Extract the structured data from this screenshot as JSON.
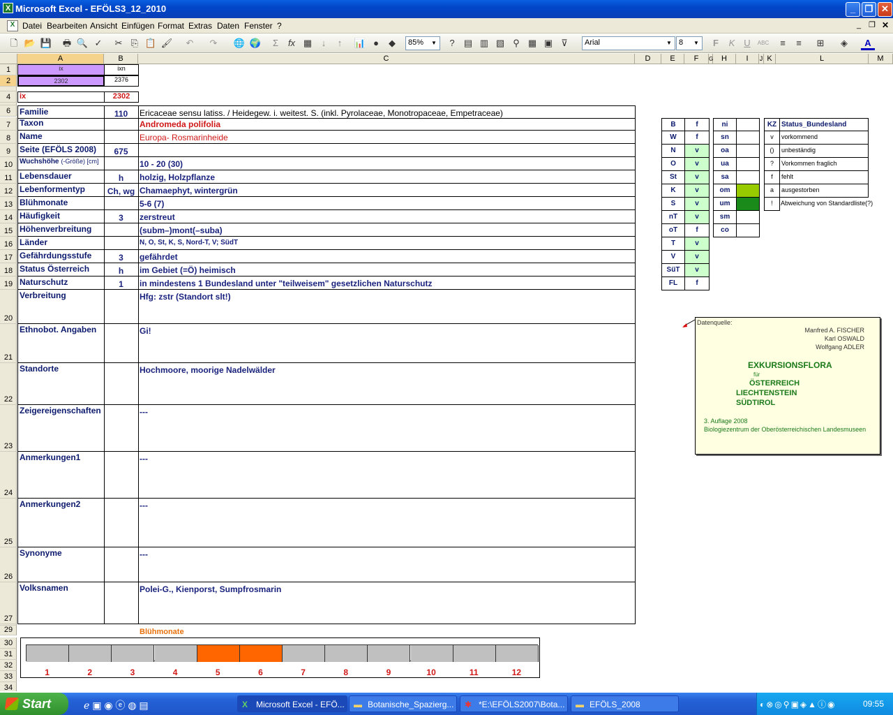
{
  "window": {
    "title": "Microsoft Excel - EFÖLS3_12_2010"
  },
  "menu": [
    "Datei",
    "Bearbeiten",
    "Ansicht",
    "Einfügen",
    "Format",
    "Extras",
    "Daten",
    "Fenster",
    "?"
  ],
  "toolbar": {
    "zoom": "85%",
    "font": "Arial",
    "size": "8"
  },
  "columns": [
    "A",
    "B",
    "C",
    "D",
    "E",
    "F",
    "G",
    "H",
    "I",
    "J",
    "K",
    "L",
    "M"
  ],
  "rows": [
    "1",
    "2",
    "4",
    "6",
    "7",
    "8",
    "9",
    "10",
    "11",
    "12",
    "13",
    "14",
    "15",
    "16",
    "17",
    "18",
    "19",
    "20",
    "21",
    "22",
    "23",
    "24",
    "25",
    "26",
    "27",
    "29",
    "30",
    "31",
    "32",
    "33",
    "34"
  ],
  "top": {
    "a1": "ix",
    "b1": "ixn",
    "a2": "2302",
    "b2": "2376",
    "a4": "ix",
    "b4": "2302"
  },
  "fields": [
    {
      "label": "Familie",
      "code": "110",
      "value": "Ericaceae sensu latiss.  /  Heidegew. i. weitest. S. (inkl. Pyrolaceae, Monotropaceae, Empetraceae)"
    },
    {
      "label": "Taxon",
      "code": "",
      "value": "Andromeda polifolia"
    },
    {
      "label": "Name",
      "code": "",
      "value": "Europa- Rosmarinheide"
    },
    {
      "label": "Seite (EFÖLS 2008)",
      "code": "675",
      "value": ""
    },
    {
      "label": "Wuchshöhe",
      "label2": "(-Größe) [cm]",
      "code": "",
      "value": " 10 - 20 (30)"
    },
    {
      "label": "Lebensdauer",
      "code": "h",
      "value": "holzig, Holzpflanze"
    },
    {
      "label": "Lebenformentyp",
      "code": "Ch, wg",
      "value": "Chamaephyt, wintergrün"
    },
    {
      "label": "Blühmonate",
      "code": "",
      "value": " 5-6 (7)"
    },
    {
      "label": "Häufigkeit",
      "code": "3",
      "value": "zerstreut"
    },
    {
      "label": "Höhenverbreitung",
      "code": "",
      "value": "(subm–)mont(–suba)"
    },
    {
      "label": "Länder",
      "code": "",
      "value": "N, O, St, K, S, Nord-T, V; SüdT"
    },
    {
      "label": "Gefährdungsstufe",
      "code": "3",
      "value": "gefährdet"
    },
    {
      "label": "Status Österreich",
      "code": "h",
      "value": "im Gebiet (=Ö) heimisch"
    },
    {
      "label": "Naturschutz",
      "code": "1",
      "value": "in mindestens 1 Bundesland unter \"teilweisem\" gesetzlichen Naturschutz"
    },
    {
      "label": "Verbreitung",
      "code": "",
      "value": "Hfg: zstr (Standort slt!)"
    },
    {
      "label": "Ethnobot. Angaben",
      "code": "",
      "value": "Gi!"
    },
    {
      "label": "Standorte",
      "code": "",
      "value": "Hochmoore, moorige Nadelwälder"
    },
    {
      "label": "Zeigereigenschaften",
      "code": "",
      "value": "---"
    },
    {
      "label": "Anmerkungen1",
      "code": "",
      "value": "---"
    },
    {
      "label": "Anmerkungen2",
      "code": "",
      "value": "---"
    },
    {
      "label": "Synonyme",
      "code": "",
      "value": "---"
    },
    {
      "label": "Volksnamen",
      "code": "",
      "value": "Polei-G., Kienporst, Sumpfrosmarin"
    }
  ],
  "states": [
    [
      "B",
      "f"
    ],
    [
      "W",
      "f"
    ],
    [
      "N",
      "v"
    ],
    [
      "O",
      "v"
    ],
    [
      "St",
      "v"
    ],
    [
      "K",
      "v"
    ],
    [
      "S",
      "v"
    ],
    [
      "nT",
      "v"
    ],
    [
      "oT",
      "f"
    ],
    [
      "T",
      "v"
    ],
    [
      "V",
      "v"
    ],
    [
      "SüT",
      "v"
    ],
    [
      "FL",
      "f"
    ]
  ],
  "zones": [
    "ni",
    "sn",
    "oa",
    "ua",
    "sa",
    "om",
    "um",
    "sm",
    "co"
  ],
  "legend": {
    "header_kz": "KZ",
    "header": "Status_Bundesland",
    "items": [
      [
        "v",
        "vorkommend"
      ],
      [
        "()",
        "unbeständig"
      ],
      [
        "?",
        "Vorkommen fraglich"
      ],
      [
        "f",
        "fehlt"
      ],
      [
        "a",
        "ausgestorben"
      ],
      [
        "!",
        "Abweichung von Standardliste(?)"
      ]
    ]
  },
  "note": {
    "src": "Datenquelle:",
    "authors": [
      "Manfred A. FISCHER",
      "Karl OSWALD",
      "Wolfgang ADLER"
    ],
    "t1": "EXKURSIONSFLORA",
    "fuer": "für",
    "t2": "ÖSTERREICH",
    "t3": "LIECHTENSTEIN",
    "t4": "SÜDTIROL",
    "ed": "3. Auflage 2008",
    "pub": "Biologiezentrum der Oberösterreichischen Landesmuseen"
  },
  "chart": {
    "title": "Blühmonate",
    "months": [
      "1",
      "2",
      "3",
      "4",
      "5",
      "6",
      "7",
      "8",
      "9",
      "10",
      "11",
      "12"
    ],
    "active": [
      5,
      6
    ],
    "on": "#ff6600",
    "off": "#c0c0c0"
  },
  "taskbar": {
    "start": "Start",
    "tasks": [
      "Microsoft Excel - EFÖ...",
      "Botanische_Spazierg...",
      "*E:\\EFÖLS2007\\Bota...",
      "EFÖLS_2008"
    ],
    "time": "09:55"
  }
}
